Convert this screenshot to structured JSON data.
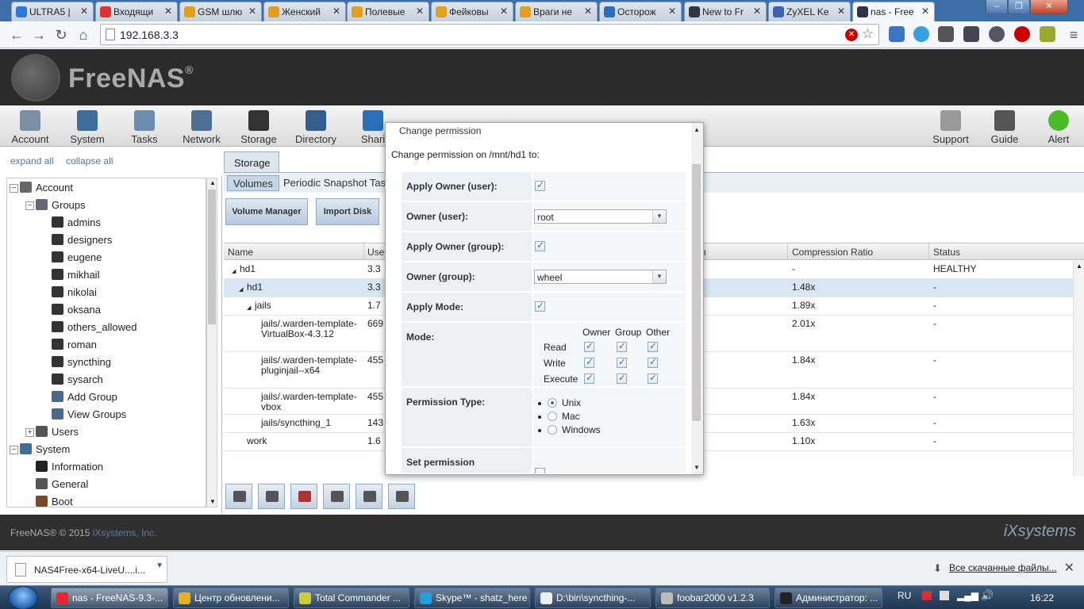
{
  "browser": {
    "tabs": [
      {
        "title": "ULTRA5 |",
        "color": "#2a7ad8"
      },
      {
        "title": "Входящи",
        "color": "#d33"
      },
      {
        "title": "GSM шлю",
        "color": "#e0a020"
      },
      {
        "title": "Женский",
        "color": "#e0a020"
      },
      {
        "title": "Полевые",
        "color": "#e0a020"
      },
      {
        "title": "Фейковы",
        "color": "#e0a020"
      },
      {
        "title": "Враги не",
        "color": "#e0a020"
      },
      {
        "title": "Осторож",
        "color": "#2a6fb8"
      },
      {
        "title": "New to Fr",
        "color": "#334"
      },
      {
        "title": "ZyXEL Ke",
        "color": "#3a64b0"
      },
      {
        "title": "nas - Free",
        "color": "#334"
      }
    ],
    "url": "192.168.3.3",
    "window_buttons": [
      "–",
      "❐",
      "✕"
    ]
  },
  "header": {
    "logo_text": "FreeNAS",
    "logo_reg": "®"
  },
  "toolbar": {
    "items": [
      {
        "label": "Account",
        "color": "#7d8fa3"
      },
      {
        "label": "System",
        "color": "#3f6d9a"
      },
      {
        "label": "Tasks",
        "color": "#6d8cb0"
      },
      {
        "label": "Network",
        "color": "#4d6f93"
      },
      {
        "label": "Storage",
        "color": "#333"
      },
      {
        "label": "Directory",
        "color": "#335f8c"
      },
      {
        "label": "Shari",
        "color": "#2a6fb8"
      }
    ],
    "right_items": [
      {
        "label": "Support",
        "color": "#999"
      },
      {
        "label": "Guide",
        "color": "#555"
      },
      {
        "label": "Alert",
        "color": "#4cbb2a"
      }
    ]
  },
  "tree": {
    "expand_all": "expand all",
    "collapse_all": "collapse all",
    "items": [
      {
        "label": "Account",
        "level": 0,
        "toggle": "−",
        "icon": "#666"
      },
      {
        "label": "Groups",
        "level": 1,
        "toggle": "−",
        "icon": "#667"
      },
      {
        "label": "admins",
        "level": 2,
        "icon": "#333"
      },
      {
        "label": "designers",
        "level": 2,
        "icon": "#333"
      },
      {
        "label": "eugene",
        "level": 2,
        "icon": "#333"
      },
      {
        "label": "mikhail",
        "level": 2,
        "icon": "#333"
      },
      {
        "label": "nikolai",
        "level": 2,
        "icon": "#333"
      },
      {
        "label": "oksana",
        "level": 2,
        "icon": "#333"
      },
      {
        "label": "others_allowed",
        "level": 2,
        "icon": "#333"
      },
      {
        "label": "roman",
        "level": 2,
        "icon": "#333"
      },
      {
        "label": "syncthing",
        "level": 2,
        "icon": "#333"
      },
      {
        "label": "sysarch",
        "level": 2,
        "icon": "#333"
      },
      {
        "label": "Add Group",
        "level": 2,
        "icon": "#4a6a8a"
      },
      {
        "label": "View Groups",
        "level": 2,
        "icon": "#4a6a8a"
      },
      {
        "label": "Users",
        "level": 1,
        "toggle": "+",
        "icon": "#555"
      },
      {
        "label": "System",
        "level": 0,
        "toggle": "−",
        "icon": "#3f6d9a"
      },
      {
        "label": "Information",
        "level": 1,
        "icon": "#222"
      },
      {
        "label": "General",
        "level": 1,
        "icon": "#555"
      },
      {
        "label": "Boot",
        "level": 1,
        "icon": "#7a4a2a"
      }
    ]
  },
  "storage": {
    "tab": "Storage",
    "subtabs": [
      "Volumes",
      "Periodic Snapshot Tasl"
    ],
    "buttons": [
      "Volume Manager",
      "Import Disk"
    ],
    "columns": [
      "Name",
      "Use",
      "n",
      "Compression Ratio",
      "Status"
    ],
    "rows": [
      {
        "name": "hd1",
        "used": "3.3",
        "ratio": "-",
        "status": "HEALTHY",
        "indent": 0,
        "arrow": "◢",
        "h": 23
      },
      {
        "name": "hd1",
        "used": "3.3",
        "ratio": "1.48x",
        "status": "-",
        "indent": 1,
        "arrow": "◢",
        "h": 23,
        "sel": true
      },
      {
        "name": "jails",
        "used": "1.7",
        "ratio": "1.89x",
        "status": "-",
        "indent": 2,
        "arrow": "◢",
        "h": 23
      },
      {
        "name": "jails/.warden-template-VirtualBox-4.3.12",
        "used": "669",
        "ratio": "2.01x",
        "status": "-",
        "indent": 3,
        "h": 46
      },
      {
        "name": "jails/.warden-template-pluginjail--x64",
        "used": "455",
        "ratio": "1.84x",
        "status": "-",
        "indent": 3,
        "h": 46
      },
      {
        "name": "jails/.warden-template-vbox",
        "used": "455",
        "ratio": "1.84x",
        "status": "-",
        "indent": 3,
        "h": 33
      },
      {
        "name": "jails/syncthing_1",
        "used": "143",
        "ratio": "1.63x",
        "status": "-",
        "indent": 3,
        "h": 23
      },
      {
        "name": "work",
        "used": "1.6",
        "ratio": "1.10x",
        "status": "-",
        "indent": 2,
        "h": 23
      }
    ]
  },
  "modal": {
    "title": "Change permission",
    "intro": "Change permission on /mnt/hd1 to:",
    "apply_owner_user": "Apply Owner (user):",
    "owner_user": "Owner (user):",
    "owner_user_value": "root",
    "apply_owner_group": "Apply Owner (group):",
    "owner_group": "Owner (group):",
    "owner_group_value": "wheel",
    "apply_mode": "Apply Mode:",
    "mode": "Mode:",
    "mode_cols": [
      "Owner",
      "Group",
      "Other"
    ],
    "mode_rows": [
      "Read",
      "Write",
      "Execute"
    ],
    "permission_type": "Permission Type:",
    "permission_options": [
      "Unix",
      "Mac",
      "Windows"
    ],
    "selected_permission": "Unix",
    "set_permission": "Set permission"
  },
  "footer": {
    "copyright": "FreeNAS® © 2015",
    "company": "iXsystems, Inc.",
    "brand": "iXsystems"
  },
  "downloads": {
    "file": "NAS4Free-x64-LiveU....i...",
    "show_all": "Все скачанные файлы...",
    "close": "✕"
  },
  "taskbar": {
    "tasks": [
      {
        "label": "nas - FreeNAS-9.3-...",
        "color": "#e23",
        "active": true
      },
      {
        "label": "Центр обновлени...",
        "color": "#e6b020"
      },
      {
        "label": "Total Commander ...",
        "color": "#cc3"
      },
      {
        "label": "Skype™ - shatz_here",
        "color": "#1fa0e0"
      },
      {
        "label": "D:\\bin\\syncthing-...",
        "color": "#eee"
      },
      {
        "label": "foobar2000 v1.2.3",
        "color": "#bbb"
      },
      {
        "label": "Администратор: ...",
        "color": "#222"
      }
    ],
    "lang": "RU",
    "time": "16:22"
  }
}
